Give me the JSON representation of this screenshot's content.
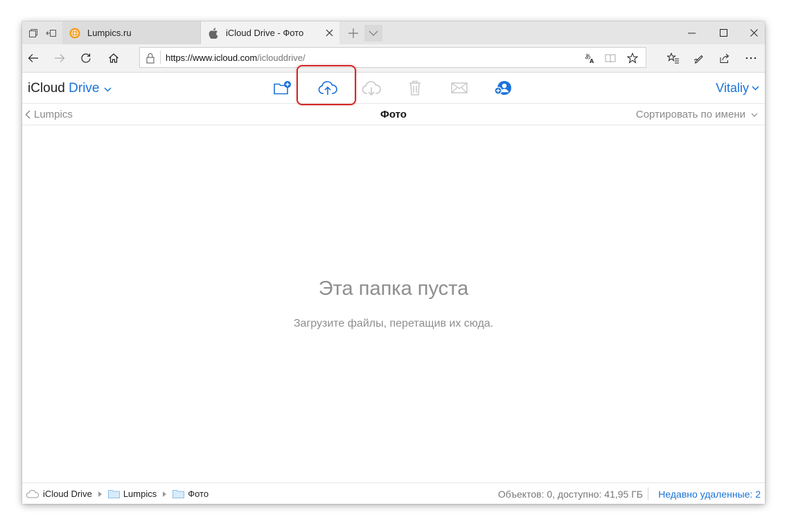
{
  "browser": {
    "tabs": [
      {
        "label": "Lumpics.ru"
      },
      {
        "label": "iCloud Drive - Фото"
      }
    ],
    "url_host": "https://www.icloud.com",
    "url_path": "/iclouddrive/"
  },
  "app": {
    "brand_icloud": "iCloud",
    "brand_drive": "Drive",
    "user_name": "Vitaliy",
    "accent_color": "#1a73d9"
  },
  "subheader": {
    "back_label": "Lumpics",
    "folder_title": "Фото",
    "sort_label": "Сортировать по имени"
  },
  "empty_state": {
    "title": "Эта папка пуста",
    "subtitle": "Загрузите файлы, перетащив их сюда."
  },
  "footer": {
    "breadcrumbs": [
      "iCloud Drive",
      "Lumpics",
      "Фото"
    ],
    "status": "Объектов: 0, доступно: 41,95 ГБ",
    "recently_deleted": "Недавно удаленные: 2"
  }
}
